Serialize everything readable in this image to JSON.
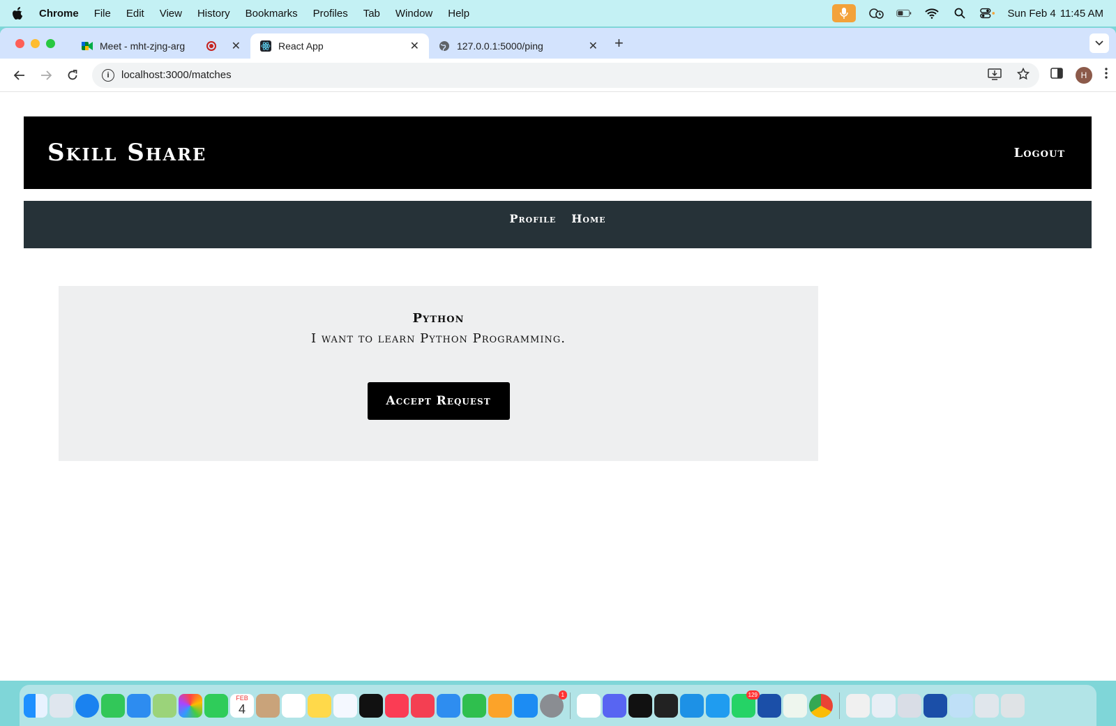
{
  "menubar": {
    "app_name": "Chrome",
    "items": [
      "File",
      "Edit",
      "View",
      "History",
      "Bookmarks",
      "Profiles",
      "Tab",
      "Window",
      "Help"
    ],
    "date": "Sun Feb 4",
    "time": "11:45 AM"
  },
  "browser": {
    "tabs": [
      {
        "title": "Meet - mht-zjng-arg",
        "active": false
      },
      {
        "title": "React App",
        "active": true
      },
      {
        "title": "127.0.0.1:5000/ping",
        "active": false
      }
    ],
    "url": "localhost:3000/matches",
    "profile_initial": "H"
  },
  "site": {
    "brand": "Skill Share",
    "logout_label": "Logout",
    "nav": {
      "profile": "Profile",
      "home": "Home"
    }
  },
  "match_card": {
    "skill": "Python",
    "description": "I want to learn Python Programming.",
    "accept_label": "Accept Request"
  },
  "dock": {
    "icons": [
      "finder-icon",
      "launchpad-icon",
      "safari-icon",
      "messages-icon",
      "mail-icon",
      "maps-icon",
      "photos-icon",
      "facetime-icon",
      "calendar-icon",
      "contacts-icon",
      "reminders-icon",
      "notes-icon",
      "freeform-icon",
      "appletv-icon",
      "music-icon",
      "news-icon",
      "keynote-icon",
      "numbers-icon",
      "pages-icon",
      "appstore-icon",
      "settings-icon",
      "slack-icon",
      "discord-icon",
      "intellij-icon",
      "terminal-icon",
      "docker-icon",
      "vscode-icon",
      "whatsapp-icon",
      "postman-icon",
      "mongodb-icon",
      "chrome-icon"
    ],
    "calendar_day": "4",
    "calendar_month": "FEB",
    "whatsapp_badge": "129",
    "settings_badge": "1"
  }
}
